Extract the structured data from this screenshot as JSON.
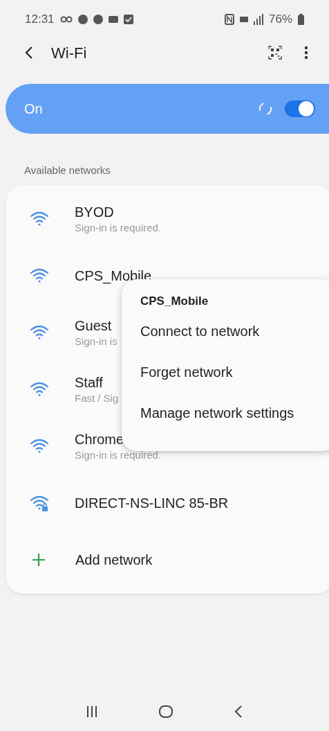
{
  "status_bar": {
    "time": "12:31",
    "battery": "76%"
  },
  "header": {
    "title": "Wi-Fi"
  },
  "wifi_switch": {
    "label": "On",
    "on": true,
    "searching": true
  },
  "section_title": "Available networks",
  "networks": [
    {
      "name": "BYOD",
      "detail": "Sign-in is required.",
      "locked": false
    },
    {
      "name": "CPS_Mobile",
      "locked": false
    },
    {
      "name": "Guest",
      "detail": "Sign-in is",
      "locked": false
    },
    {
      "name": "Staff",
      "detail": "Fast / Sig",
      "locked": false
    },
    {
      "name": "Chrome",
      "detail": "Sign-in is required.",
      "locked": false
    },
    {
      "name": "DIRECT-NS-LINC 85-BR",
      "locked": true
    }
  ],
  "add_network": "Add network",
  "context_menu": {
    "title": "CPS_Mobile",
    "items": [
      "Connect to network",
      "Forget network",
      "Manage network settings"
    ]
  }
}
